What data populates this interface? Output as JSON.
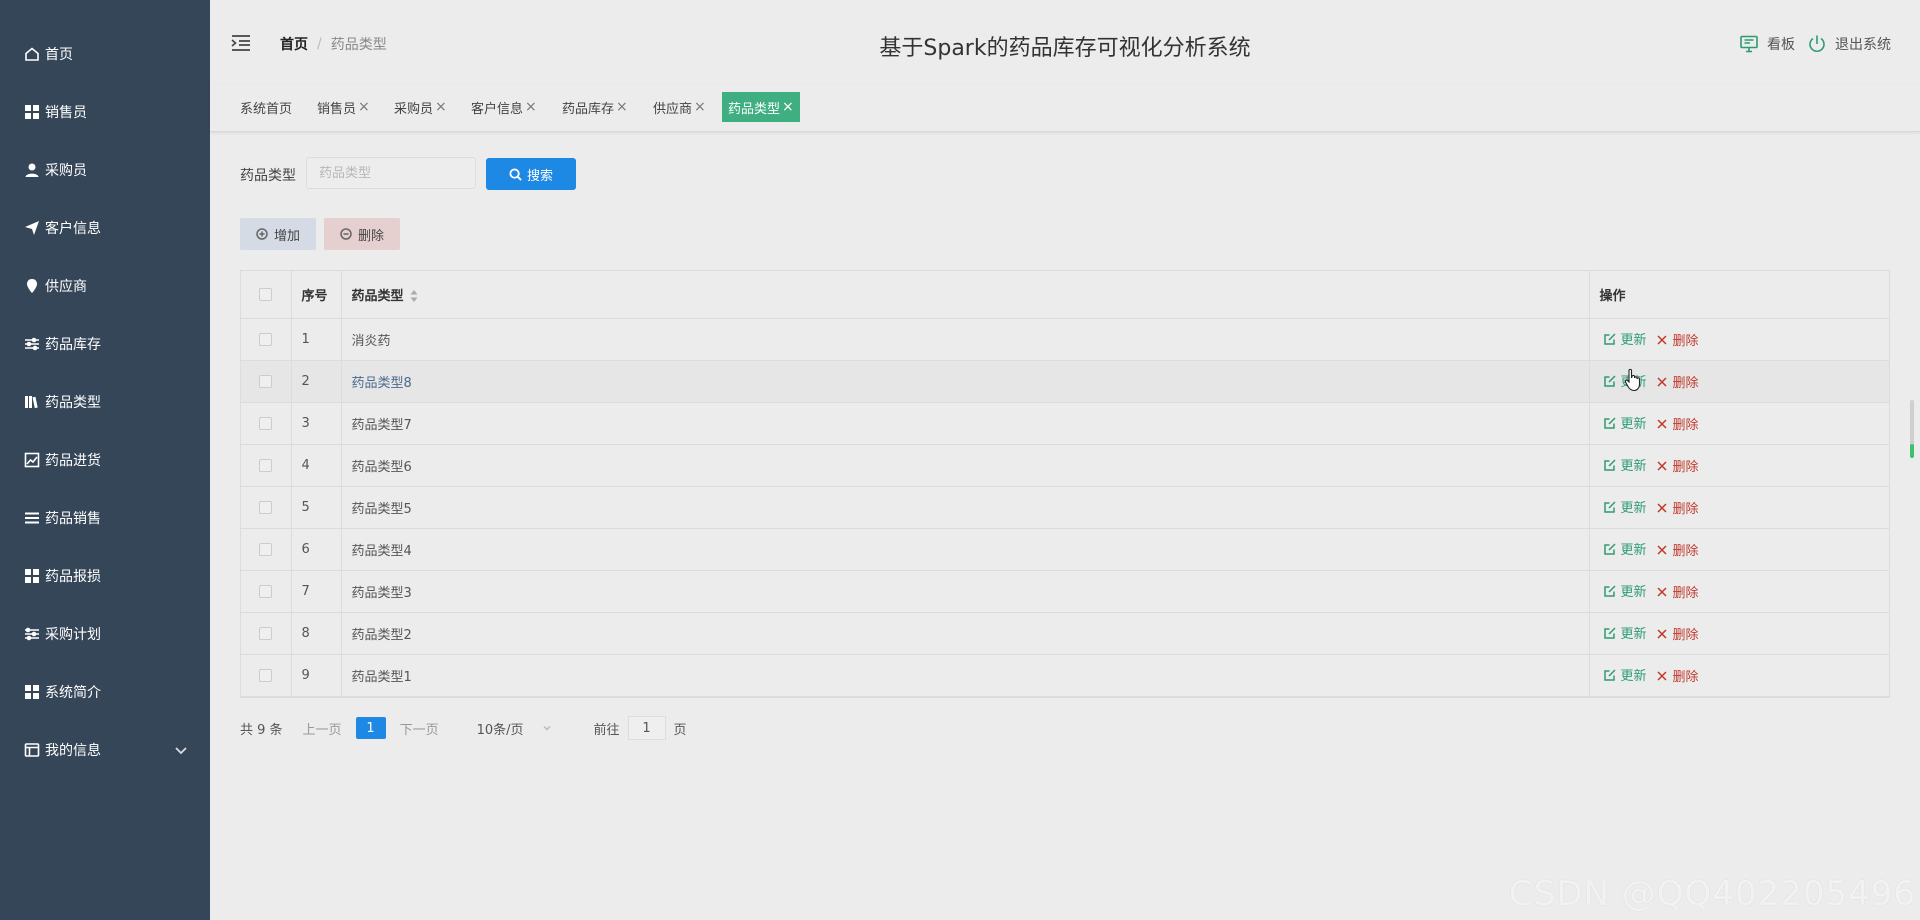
{
  "sidebar": {
    "items": [
      {
        "label": "首页",
        "icon": "home-icon"
      },
      {
        "label": "销售员",
        "icon": "grid-icon"
      },
      {
        "label": "采购员",
        "icon": "user-icon"
      },
      {
        "label": "客户信息",
        "icon": "paper-plane-icon"
      },
      {
        "label": "供应商",
        "icon": "map-pin-icon"
      },
      {
        "label": "药品库存",
        "icon": "sliders-icon"
      },
      {
        "label": "药品类型",
        "icon": "books-icon"
      },
      {
        "label": "药品进货",
        "icon": "chart-icon"
      },
      {
        "label": "药品销售",
        "icon": "list-icon"
      },
      {
        "label": "药品报损",
        "icon": "grid-icon"
      },
      {
        "label": "采购计划",
        "icon": "sliders-icon"
      },
      {
        "label": "系统简介",
        "icon": "grid-icon"
      },
      {
        "label": "我的信息",
        "icon": "window-icon"
      }
    ]
  },
  "header": {
    "breadcrumb_home": "首页",
    "breadcrumb_current": "药品类型",
    "title": "基于Spark的药品库存可视化分析系统",
    "board_label": "看板",
    "logout_label": "退出系统"
  },
  "tags": [
    {
      "label": "系统首页",
      "closable": false
    },
    {
      "label": "销售员",
      "closable": true
    },
    {
      "label": "采购员",
      "closable": true
    },
    {
      "label": "客户信息",
      "closable": true
    },
    {
      "label": "药品库存",
      "closable": true
    },
    {
      "label": "供应商",
      "closable": true
    },
    {
      "label": "药品类型",
      "closable": true,
      "active": true
    }
  ],
  "search": {
    "label": "药品类型",
    "placeholder": "药品类型",
    "button": "搜索"
  },
  "actions": {
    "add": "增加",
    "delete": "删除"
  },
  "table": {
    "headers": {
      "index": "序号",
      "name": "药品类型",
      "op": "操作"
    },
    "rows": [
      {
        "index": "1",
        "name": "消炎药"
      },
      {
        "index": "2",
        "name": "药品类型8"
      },
      {
        "index": "3",
        "name": "药品类型7"
      },
      {
        "index": "4",
        "name": "药品类型6"
      },
      {
        "index": "5",
        "name": "药品类型5"
      },
      {
        "index": "6",
        "name": "药品类型4"
      },
      {
        "index": "7",
        "name": "药品类型3"
      },
      {
        "index": "8",
        "name": "药品类型2"
      },
      {
        "index": "9",
        "name": "药品类型1"
      }
    ],
    "update_label": "更新",
    "delete_label": "删除"
  },
  "pager": {
    "total": "共 9 条",
    "prev": "上一页",
    "current": "1",
    "next": "下一页",
    "size": "10条/页",
    "goto": "前往",
    "jump_value": "1",
    "page_unit": "页"
  },
  "watermark": "CSDN @QQ402205496",
  "colors": {
    "sidebar_bg": "#364659",
    "accent_green": "#3fae80",
    "primary_blue": "#1e88e5",
    "danger_red": "#c0392b"
  }
}
